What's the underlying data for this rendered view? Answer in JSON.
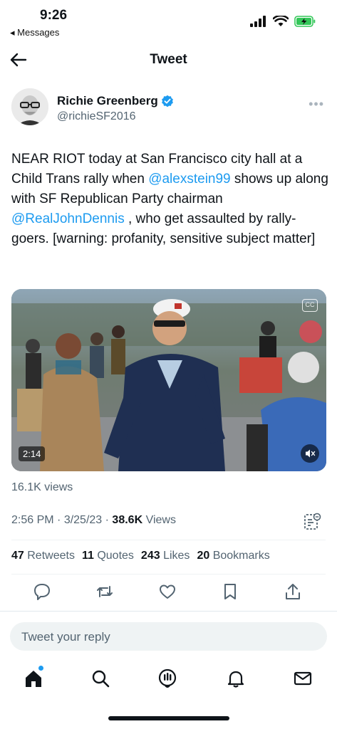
{
  "status_bar": {
    "time": "9:26",
    "back_app": "◂ Messages"
  },
  "nav": {
    "title": "Tweet"
  },
  "author": {
    "name": "Richie Greenberg",
    "handle": "@richieSF2016"
  },
  "tweet": {
    "text_1": "NEAR RIOT today at San Francisco city hall at a Child Trans rally when ",
    "mention_1": "@alexstein99",
    "text_2": " shows up along with SF Republican Party chairman ",
    "mention_2": "@RealJohnDennis",
    "text_3": " , who get assaulted by rally-goers. [warning: profanity, sensitive subject matter]"
  },
  "media": {
    "duration": "2:14",
    "cc_label": "CC"
  },
  "views_small": "16.1K views",
  "meta": {
    "time": "2:56 PM",
    "sep": " · ",
    "date": "3/25/23",
    "views_count": "38.6K",
    "views_label": " Views"
  },
  "stats": [
    {
      "count": "47",
      "label": "Retweets"
    },
    {
      "count": "11",
      "label": "Quotes"
    },
    {
      "count": "243",
      "label": "Likes"
    },
    {
      "count": "20",
      "label": "Bookmarks"
    }
  ],
  "reply": {
    "placeholder": "Tweet your reply"
  },
  "icons": {
    "back": "back-arrow-icon",
    "verified": "verified-badge-icon",
    "more": "more-icon",
    "reply": "reply-icon",
    "retweet": "retweet-icon",
    "like": "heart-icon",
    "bookmark": "bookmark-icon",
    "share": "share-icon",
    "home": "home-icon",
    "search": "search-icon",
    "spaces": "spaces-icon",
    "notifications": "bell-icon",
    "messages": "mail-icon"
  },
  "colors": {
    "accent": "#1d9bf0",
    "text": "#0f1419",
    "secondary": "#536471",
    "battery": "#34c759"
  }
}
